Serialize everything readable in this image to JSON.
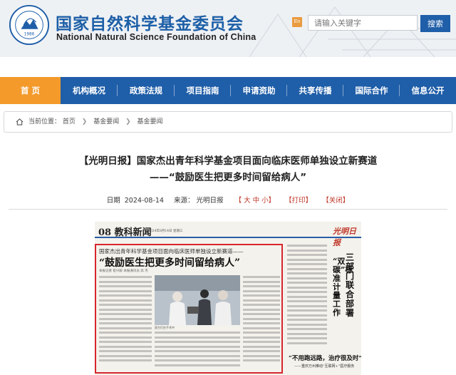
{
  "header": {
    "title_cn": "国家自然科学基金委员会",
    "title_en": "National Natural Science Foundation of China",
    "logo_year": "1986",
    "lang_button": "En",
    "search_placeholder": "请输入关键字",
    "search_button": "搜索"
  },
  "nav": {
    "items": [
      {
        "label": "首  页",
        "active": true
      },
      {
        "label": "机构概况"
      },
      {
        "label": "政策法规"
      },
      {
        "label": "项目指南"
      },
      {
        "label": "申请资助"
      },
      {
        "label": "共享传播"
      },
      {
        "label": "国际合作"
      },
      {
        "label": "信息公开"
      }
    ]
  },
  "breadcrumb": {
    "prefix": "当前位置：",
    "items": [
      "首页",
      "基金要闻",
      "基金要闻"
    ]
  },
  "article": {
    "title_line1": "【光明日报】国家杰出青年科学基金项目面向临床医师单独设立新赛道",
    "title_line2": "——“鼓励医生把更多时间留给病人”",
    "date_label": "日期",
    "date": "2024-08-14",
    "source_label": "来源：",
    "source": "光明日报",
    "font_size_control": "【 大 中 小】",
    "print": "【打印】",
    "close": "【关闭】"
  },
  "newspaper": {
    "page_header": "08  教科新闻",
    "brand": "光明日报",
    "date_line": "2024年8月14日  星期三",
    "subhead": "国家杰出青年科学基金项目面向临床医师单独设立新赛道——",
    "headline": "“鼓励医生把更多时间留给病人”",
    "byline": "本报记者  崔兴毅  本报通讯员  高  杰",
    "photo_caption": "医生们在手术中",
    "side_title_a": "三部门联合部署",
    "side_title_b": "“双碳”标准计量工作",
    "side_quote": "“不用跑远路，治疗很及时”",
    "side_quote_sub": "——重庆万州推动“互联网+”医疗服务"
  },
  "colors": {
    "brand_blue": "#1f5ea8",
    "nav_active": "#f39a2b",
    "red_box": "#d7262e"
  }
}
